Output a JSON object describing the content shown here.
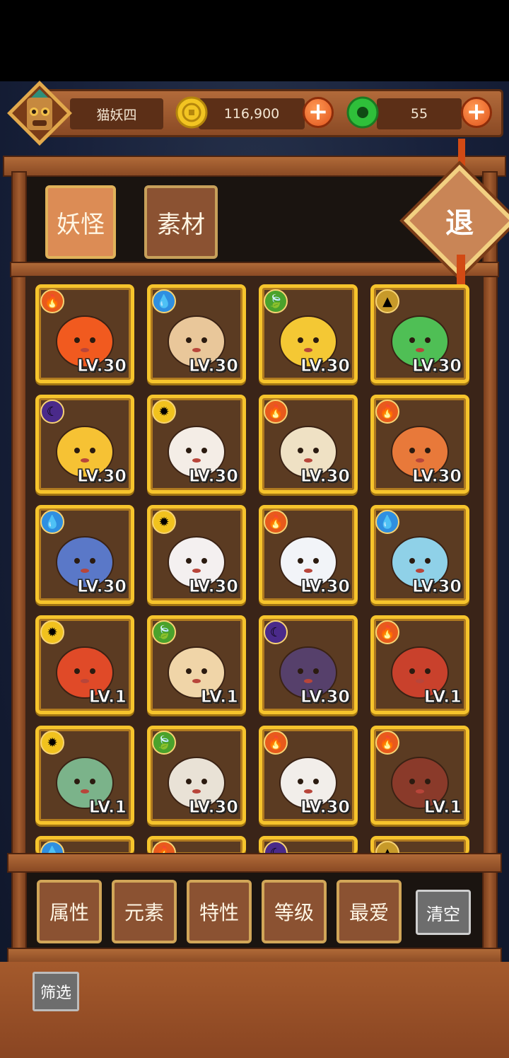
{
  "player": {
    "name": "猫妖四"
  },
  "currencies": [
    {
      "name": "coin",
      "value": "116,900",
      "color": "#f2c422"
    },
    {
      "name": "jade",
      "value": "55",
      "color": "#2fbf3a"
    }
  ],
  "tabs": [
    {
      "label": "妖怪",
      "active": true
    },
    {
      "label": "素材",
      "active": false
    }
  ],
  "exit_label": "退",
  "monsters": [
    {
      "element": "fire",
      "level": "LV.30",
      "art": "fire-spirit"
    },
    {
      "element": "water",
      "level": "LV.30",
      "art": "sprout-bun"
    },
    {
      "element": "wood",
      "level": "LV.30",
      "art": "corn-sprite"
    },
    {
      "element": "earth",
      "level": "LV.30",
      "art": "cactus-fan"
    },
    {
      "element": "dark",
      "level": "LV.30",
      "art": "mango-stick"
    },
    {
      "element": "light",
      "level": "LV.30",
      "art": "ghost-bun"
    },
    {
      "element": "fire",
      "level": "LV.30",
      "art": "egg-bat"
    },
    {
      "element": "fire",
      "level": "LV.30",
      "art": "fox-spirit"
    },
    {
      "element": "water",
      "level": "LV.30",
      "art": "blue-swordsman"
    },
    {
      "element": "light",
      "level": "LV.30",
      "art": "bride"
    },
    {
      "element": "fire",
      "level": "LV.30",
      "art": "mahjong-tile"
    },
    {
      "element": "water",
      "level": "LV.30",
      "art": "rainbow-phoenix"
    },
    {
      "element": "light",
      "level": "LV.1",
      "art": "monkey-king"
    },
    {
      "element": "wood",
      "level": "LV.1",
      "art": "coin-girl"
    },
    {
      "element": "dark",
      "level": "LV.30",
      "art": "cat-girl"
    },
    {
      "element": "fire",
      "level": "LV.1",
      "art": "bull-demon"
    },
    {
      "element": "light",
      "level": "LV.1",
      "art": "green-beast"
    },
    {
      "element": "wood",
      "level": "LV.30",
      "art": "flower-maiden"
    },
    {
      "element": "fire",
      "level": "LV.30",
      "art": "gift-box"
    },
    {
      "element": "fire",
      "level": "LV.1",
      "art": "empress"
    }
  ],
  "partial_row_elements": [
    "water",
    "fire",
    "dark",
    "earth"
  ],
  "element_colors": {
    "fire": "#e85a1c",
    "water": "#2f8fe0",
    "wood": "#4aa22c",
    "earth": "#c79a2a",
    "dark": "#4a2a8a",
    "light": "#f1c21e"
  },
  "filters": [
    "属性",
    "元素",
    "特性",
    "等级",
    "最爱"
  ],
  "clear_label": "清空",
  "screen_label": "筛选"
}
